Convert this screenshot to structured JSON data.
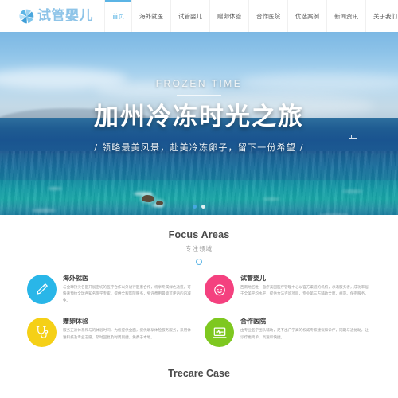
{
  "header": {
    "logo_text": "试管婴儿",
    "logo_icon": "snowflake-fan-logo-icon",
    "nav": [
      {
        "label": "首页",
        "active": true
      },
      {
        "label": "海外就医",
        "active": false
      },
      {
        "label": "试管婴儿",
        "active": false
      },
      {
        "label": "赠卵体验",
        "active": false
      },
      {
        "label": "合作医院",
        "active": false
      },
      {
        "label": "优选案例",
        "active": false
      },
      {
        "label": "新闻资讯",
        "active": false
      },
      {
        "label": "关于我们",
        "active": false
      }
    ]
  },
  "hero": {
    "eyebrow": "FROZEN TIME",
    "title": "加州冷冻时光之旅",
    "subtitle": "/ 领略最美风景，赴美冷冻卵子，留下一份希望 /",
    "slides": [
      {
        "active": true
      },
      {
        "active": false
      }
    ]
  },
  "focus": {
    "title": "Focus Areas",
    "subtitle": "专注领域",
    "cards": [
      {
        "title": "海外就医",
        "icon": "pen-icon",
        "color": "#29b6e8",
        "desc": "与全球顶尖名医开展密切的医疗合作以外进行医患合作，将享专属绿色通道，可快速预约全球各知名医学专家，提供全程医院服务，免许费用最简可评语的内减免。"
      },
      {
        "title": "试管婴儿",
        "icon": "baby-face-icon",
        "color": "#f4417f",
        "desc": "西南地区唯一自疗美国医疗管理中心以官方渠道的机构，承邀服务者，成功率居于全美平均水平，提供合法咨询项目，专业第三方辅助全面、规范、保密服务。"
      },
      {
        "title": "赠卵体验",
        "icon": "stethoscope-icon",
        "color": "#f5d017",
        "desc": "服务正洲体系和与的体验时间，为您提供全面，提供助孕体检服务服务，采用体进科技及专业志愿，及时回复及时周到捷，免费于本地。"
      },
      {
        "title": "合作医院",
        "icon": "laptop-monitor-icon",
        "color": "#7ec820",
        "desc": "由专业医学团队辅助，足不出户学高的权威专家建议和诊疗，同期与通协助，让诊疗更简单、高速和快捷。"
      }
    ]
  },
  "case": {
    "title": "Trecare Case"
  }
}
